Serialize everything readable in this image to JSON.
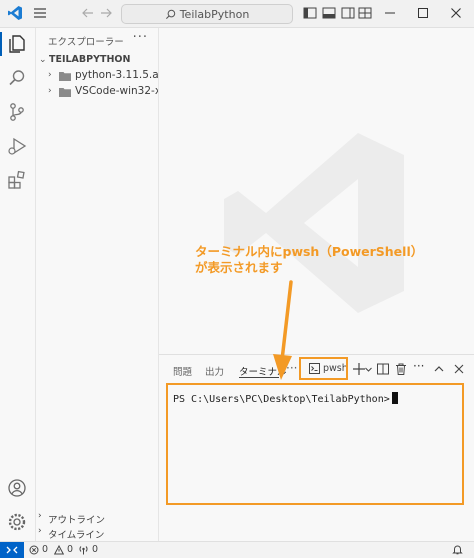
{
  "titlebar": {
    "search_text": "TeilabPython"
  },
  "explorer": {
    "title": "エクスプローラー",
    "more": "···",
    "root_folder": "TEILABPYTHON",
    "items": [
      {
        "label": "python-3.11.5.am..."
      },
      {
        "label": "VSCode-win32-x6..."
      }
    ]
  },
  "sections": {
    "outline": "アウトライン",
    "timeline": "タイムライン"
  },
  "panel": {
    "tabs": [
      "問題",
      "出力",
      "ターミナル"
    ],
    "active_tab": "ターミナル",
    "more": "···",
    "terminal_chip": "pwsh",
    "prompt": "PS C:\\Users\\PC\\Desktop\\TeilabPython>"
  },
  "statusbar": {
    "errors": "0",
    "warnings": "0",
    "ports": "0"
  },
  "annotation": {
    "line1": "ターミナル内にpwsh（PowerShell）",
    "line2": "が表示されます"
  },
  "colors": {
    "accent_blue": "#0063c8",
    "annotation_orange": "#f39a26"
  }
}
